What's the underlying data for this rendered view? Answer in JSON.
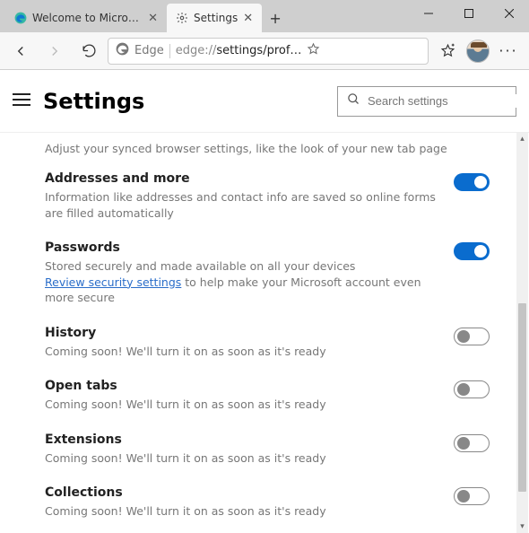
{
  "window": {
    "tabs": [
      {
        "title": "Welcome to Microsof…",
        "active": false
      },
      {
        "title": "Settings",
        "active": true
      }
    ]
  },
  "toolbar": {
    "edge_label": "Edge",
    "url_prefix": "edge://",
    "url_rest": "settings/prof…"
  },
  "header": {
    "title": "Settings",
    "search_placeholder": "Search settings"
  },
  "content": {
    "sync_description": "Adjust your synced browser settings, like the look of your new tab page",
    "items": [
      {
        "title": "Addresses and more",
        "desc": "Information like addresses and contact info are saved so online forms are filled automatically",
        "toggle": "on"
      },
      {
        "title": "Passwords",
        "desc_pre": "Stored securely and made available on all your devices",
        "link": "Review security settings",
        "desc_post": " to help make your Microsoft account even more secure",
        "toggle": "on"
      },
      {
        "title": "History",
        "desc": "Coming soon! We'll turn it on as soon as it's ready",
        "toggle": "off"
      },
      {
        "title": "Open tabs",
        "desc": "Coming soon! We'll turn it on as soon as it's ready",
        "toggle": "off"
      },
      {
        "title": "Extensions",
        "desc": "Coming soon! We'll turn it on as soon as it's ready",
        "toggle": "off"
      },
      {
        "title": "Collections",
        "desc": "Coming soon! We'll turn it on as soon as it's ready",
        "toggle": "off"
      }
    ]
  }
}
